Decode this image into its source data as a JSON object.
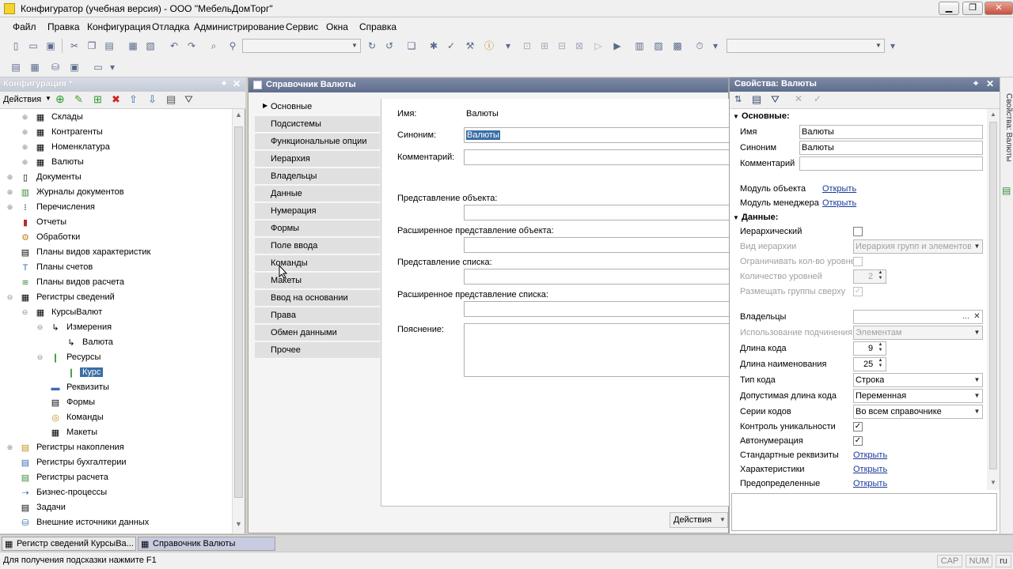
{
  "window": {
    "title": "Конфигуратор (учебная версия) - ООО \"МебельДомТорг\"",
    "min": "▁",
    "max": "❐",
    "close": "✕"
  },
  "menu": [
    "Файл",
    "Правка",
    "Конфигурация",
    "Отладка",
    "Администрирование",
    "Сервис",
    "Окна",
    "Справка"
  ],
  "left_panel": {
    "title": "Конфигурация *",
    "actions_label": "Действия",
    "tree": [
      {
        "label": "Склады",
        "level": 2,
        "icon": "catalog-icon"
      },
      {
        "label": "Контрагенты",
        "level": 2,
        "icon": "catalog-icon"
      },
      {
        "label": "Номенклатура",
        "level": 2,
        "icon": "catalog-icon"
      },
      {
        "label": "Валюты",
        "level": 2,
        "icon": "catalog-icon"
      },
      {
        "label": "Документы",
        "level": 1,
        "icon": "document-icon"
      },
      {
        "label": "Журналы документов",
        "level": 1,
        "icon": "journal-icon"
      },
      {
        "label": "Перечисления",
        "level": 1,
        "icon": "enum-icon"
      },
      {
        "label": "Отчеты",
        "level": 1,
        "icon": "report-icon"
      },
      {
        "label": "Обработки",
        "level": 1,
        "icon": "processing-icon"
      },
      {
        "label": "Планы видов характеристик",
        "level": 1,
        "icon": "chart-of-characteristics-icon"
      },
      {
        "label": "Планы счетов",
        "level": 1,
        "icon": "chart-of-accounts-icon"
      },
      {
        "label": "Планы видов расчета",
        "level": 1,
        "icon": "calculation-types-icon"
      },
      {
        "label": "Регистры сведений",
        "level": 1,
        "icon": "info-register-icon"
      },
      {
        "label": "КурсыВалют",
        "level": 2,
        "icon": "info-register-icon"
      },
      {
        "label": "Измерения",
        "level": 3,
        "icon": "dimensions-icon"
      },
      {
        "label": "Валюта",
        "level": 4,
        "icon": "dimension-icon"
      },
      {
        "label": "Ресурсы",
        "level": 3,
        "icon": "resources-icon"
      },
      {
        "label": "Курс",
        "level": 4,
        "icon": "resource-icon",
        "selected": true
      },
      {
        "label": "Реквизиты",
        "level": 3,
        "icon": "attributes-icon"
      },
      {
        "label": "Формы",
        "level": 3,
        "icon": "forms-icon"
      },
      {
        "label": "Команды",
        "level": 3,
        "icon": "commands-icon"
      },
      {
        "label": "Макеты",
        "level": 3,
        "icon": "templates-icon"
      },
      {
        "label": "Регистры накопления",
        "level": 1,
        "icon": "accumulation-register-icon"
      },
      {
        "label": "Регистры бухгалтерии",
        "level": 1,
        "icon": "accounting-register-icon"
      },
      {
        "label": "Регистры расчета",
        "level": 1,
        "icon": "calculation-register-icon"
      },
      {
        "label": "Бизнес-процессы",
        "level": 1,
        "icon": "business-process-icon"
      },
      {
        "label": "Задачи",
        "level": 1,
        "icon": "tasks-icon"
      },
      {
        "label": "Внешние источники данных",
        "level": 1,
        "icon": "external-data-icon"
      }
    ]
  },
  "center_panel": {
    "title": "Справочник Валюты",
    "tabs": [
      "Основные",
      "Подсистемы",
      "Функциональные опции",
      "Иерархия",
      "Владельцы",
      "Данные",
      "Нумерация",
      "Формы",
      "Поле ввода",
      "Команды",
      "Макеты",
      "Ввод на основании",
      "Права",
      "Обмен данными",
      "Прочее"
    ],
    "active_tab": "Основные",
    "fields": {
      "name_label": "Имя:",
      "name_value": "Валюты",
      "synonym_label": "Синоним:",
      "synonym_value": "Валюты",
      "comment_label": "Комментарий:",
      "object_repr_label": "Представление объекта:",
      "ext_object_repr_label": "Расширенное представление объекта:",
      "list_repr_label": "Представление списка:",
      "ext_list_repr_label": "Расширенное представление списка:",
      "explanation_label": "Пояснение:"
    },
    "actions_label": "Действия"
  },
  "right_panel": {
    "title": "Свойства: Валюты",
    "section_main": "Основные:",
    "section_data": "Данные:",
    "props": {
      "name_label": "Имя",
      "name_value": "Валюты",
      "synonym_label": "Синоним",
      "synonym_value": "Валюты",
      "comment_label": "Комментарий",
      "object_module_label": "Модуль объекта",
      "object_module_link": "Открыть",
      "manager_module_label": "Модуль менеджера",
      "manager_module_link": "Открыть",
      "hierarchical_label": "Иерархический",
      "hierarchy_type_label": "Вид иерархии",
      "hierarchy_type_value": "Иерархия групп и элементов",
      "limit_levels_label": "Ограничивать кол-во уровней",
      "levels_count_label": "Количество уровней",
      "levels_count_value": "2",
      "groups_top_label": "Размещать группы сверху",
      "owners_label": "Владельцы",
      "subordination_label": "Использование подчинения",
      "subordination_value": "Элементам",
      "code_length_label": "Длина кода",
      "code_length_value": "9",
      "name_length_label": "Длина наименования",
      "name_length_value": "25",
      "code_type_label": "Тип кода",
      "code_type_value": "Строка",
      "allowed_code_length_label": "Допустимая длина кода",
      "allowed_code_length_value": "Переменная",
      "code_series_label": "Серии кодов",
      "code_series_value": "Во всем справочнике",
      "uniqueness_label": "Контроль уникальности",
      "autonumbering_label": "Автонумерация",
      "standard_attrs_label": "Стандартные реквизиты",
      "standard_attrs_link": "Открыть",
      "characteristics_label": "Характеристики",
      "characteristics_link": "Открыть",
      "predefined_label": "Предопределенные",
      "predefined_link": "Открыть"
    }
  },
  "side_strip_label": "Свойства: Валюты",
  "taskbar": [
    "Регистр сведений КурсыВа...",
    "Справочник Валюты"
  ],
  "status": {
    "hint": "Для получения подсказки нажмите F1",
    "cap": "CAP",
    "num": "NUM",
    "lang": "ru"
  }
}
